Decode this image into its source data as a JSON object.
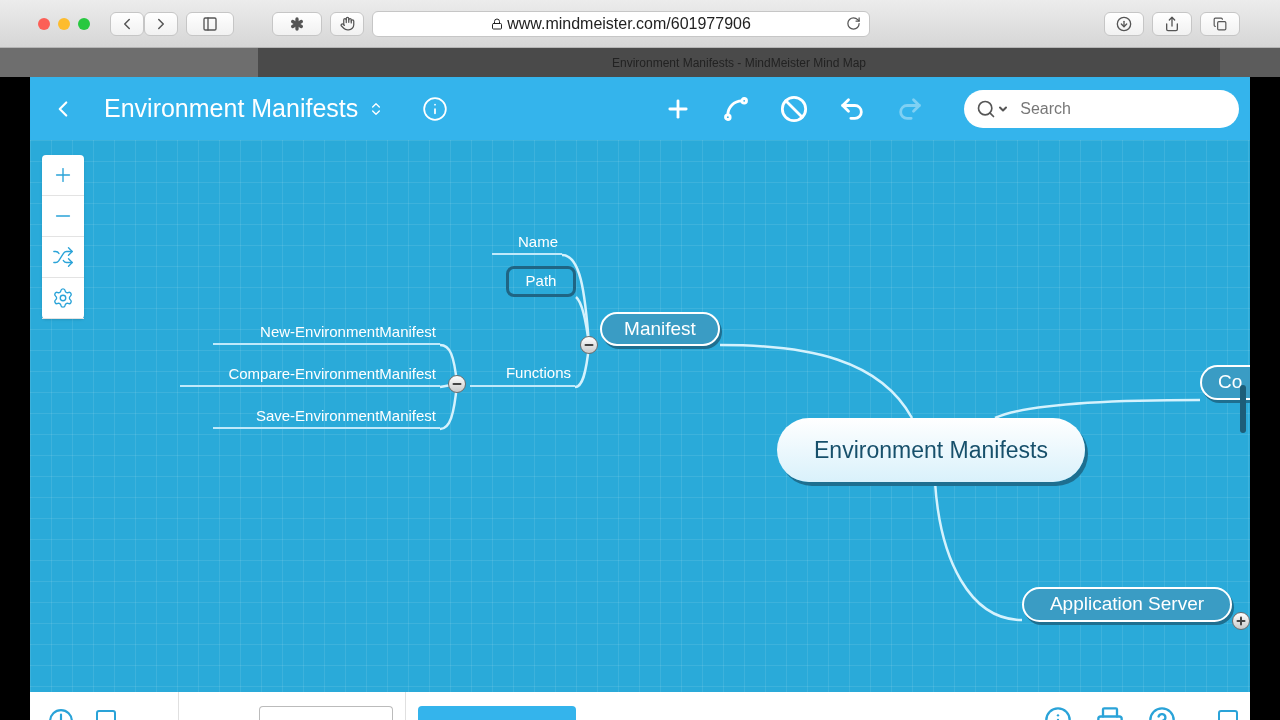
{
  "browser": {
    "url": "www.mindmeister.com/601977906",
    "tab_title": "Environment Manifests - MindMeister Mind Map"
  },
  "header": {
    "title": "Environment Manifests",
    "search": {
      "placeholder": "Search"
    },
    "tools": [
      {
        "kind": "add",
        "disabled": false
      },
      {
        "kind": "connect",
        "disabled": false
      },
      {
        "kind": "block",
        "disabled": false
      },
      {
        "kind": "undo",
        "disabled": false
      },
      {
        "kind": "redo",
        "disabled": true
      }
    ]
  },
  "zoom_panel": [
    {
      "kind": "zoom-in"
    },
    {
      "kind": "zoom-out"
    },
    {
      "kind": "layout"
    },
    {
      "kind": "settings"
    }
  ],
  "map": {
    "root": {
      "kind": "root",
      "text": "Environment Manifests",
      "selected": false,
      "children": [
        {
          "kind": "topic",
          "text": "Manifest",
          "selected": false,
          "expanded": true,
          "children": [
            {
              "kind": "subtopic",
              "text": "Name",
              "selected": false
            },
            {
              "kind": "subtopic",
              "text": "Path",
              "selected": true
            },
            {
              "kind": "subtopic",
              "text": "Functions",
              "selected": false,
              "expanded": true,
              "children": [
                {
                  "kind": "subtopic",
                  "text": "New-EnvironmentManifest",
                  "selected": false
                },
                {
                  "kind": "subtopic",
                  "text": "Compare-EnvironmentManifest",
                  "selected": false
                },
                {
                  "kind": "subtopic",
                  "text": "Save-EnvironmentManifest",
                  "selected": false
                }
              ]
            }
          ]
        },
        {
          "kind": "topic",
          "text": "Co",
          "selected": false
        },
        {
          "kind": "topic",
          "text": "Application Server",
          "selected": false,
          "expanded": false
        }
      ]
    }
  }
}
